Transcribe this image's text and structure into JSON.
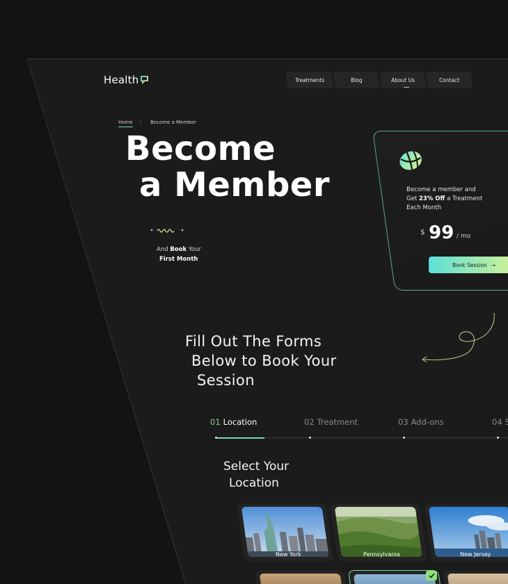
{
  "header": {
    "logo_text": "Health",
    "nav": [
      {
        "label": "Treatments"
      },
      {
        "label": "Blog"
      },
      {
        "label": "About Us"
      },
      {
        "label": "Contact"
      }
    ]
  },
  "breadcrumb": {
    "home": "Home",
    "separator": "\\",
    "current": "Become a Member"
  },
  "hero": {
    "line1": "Become",
    "line2": "a Member",
    "sub_prefix": "And",
    "sub_bold1": "Book",
    "sub_suffix": "Your",
    "sub_bold2": "First Month"
  },
  "membership_card": {
    "line1": "Become a member and",
    "line2_prefix": "Get",
    "line2_bold": "23% Off",
    "line2_suffix": "a Treatment",
    "line3": "Each Month",
    "currency": "$",
    "price": "99",
    "per": "/ mo",
    "button_label": "Book Session",
    "button_arrow": "→"
  },
  "forms_section": {
    "title_lines": [
      "Fill Out The Forms",
      "Below to Book Your",
      "Session"
    ]
  },
  "steps": [
    {
      "num": "01",
      "label": "Location",
      "active": true
    },
    {
      "num": "02",
      "label": "Treatment",
      "active": false
    },
    {
      "num": "03",
      "label": "Add-ons",
      "active": false
    },
    {
      "num": "04",
      "label": "S",
      "active": false
    }
  ],
  "location_section": {
    "title_lines": [
      "Select Your",
      "Location"
    ],
    "locations": [
      {
        "name": "New York"
      },
      {
        "name": "Pennsylvania"
      },
      {
        "name": "New Jersey"
      }
    ]
  },
  "colors": {
    "background": "#131313",
    "surface": "#1b1b1b",
    "accent_green": "#7fd6b0",
    "gradient_start": "#5de0d8",
    "gradient_end": "#e7f58a"
  }
}
